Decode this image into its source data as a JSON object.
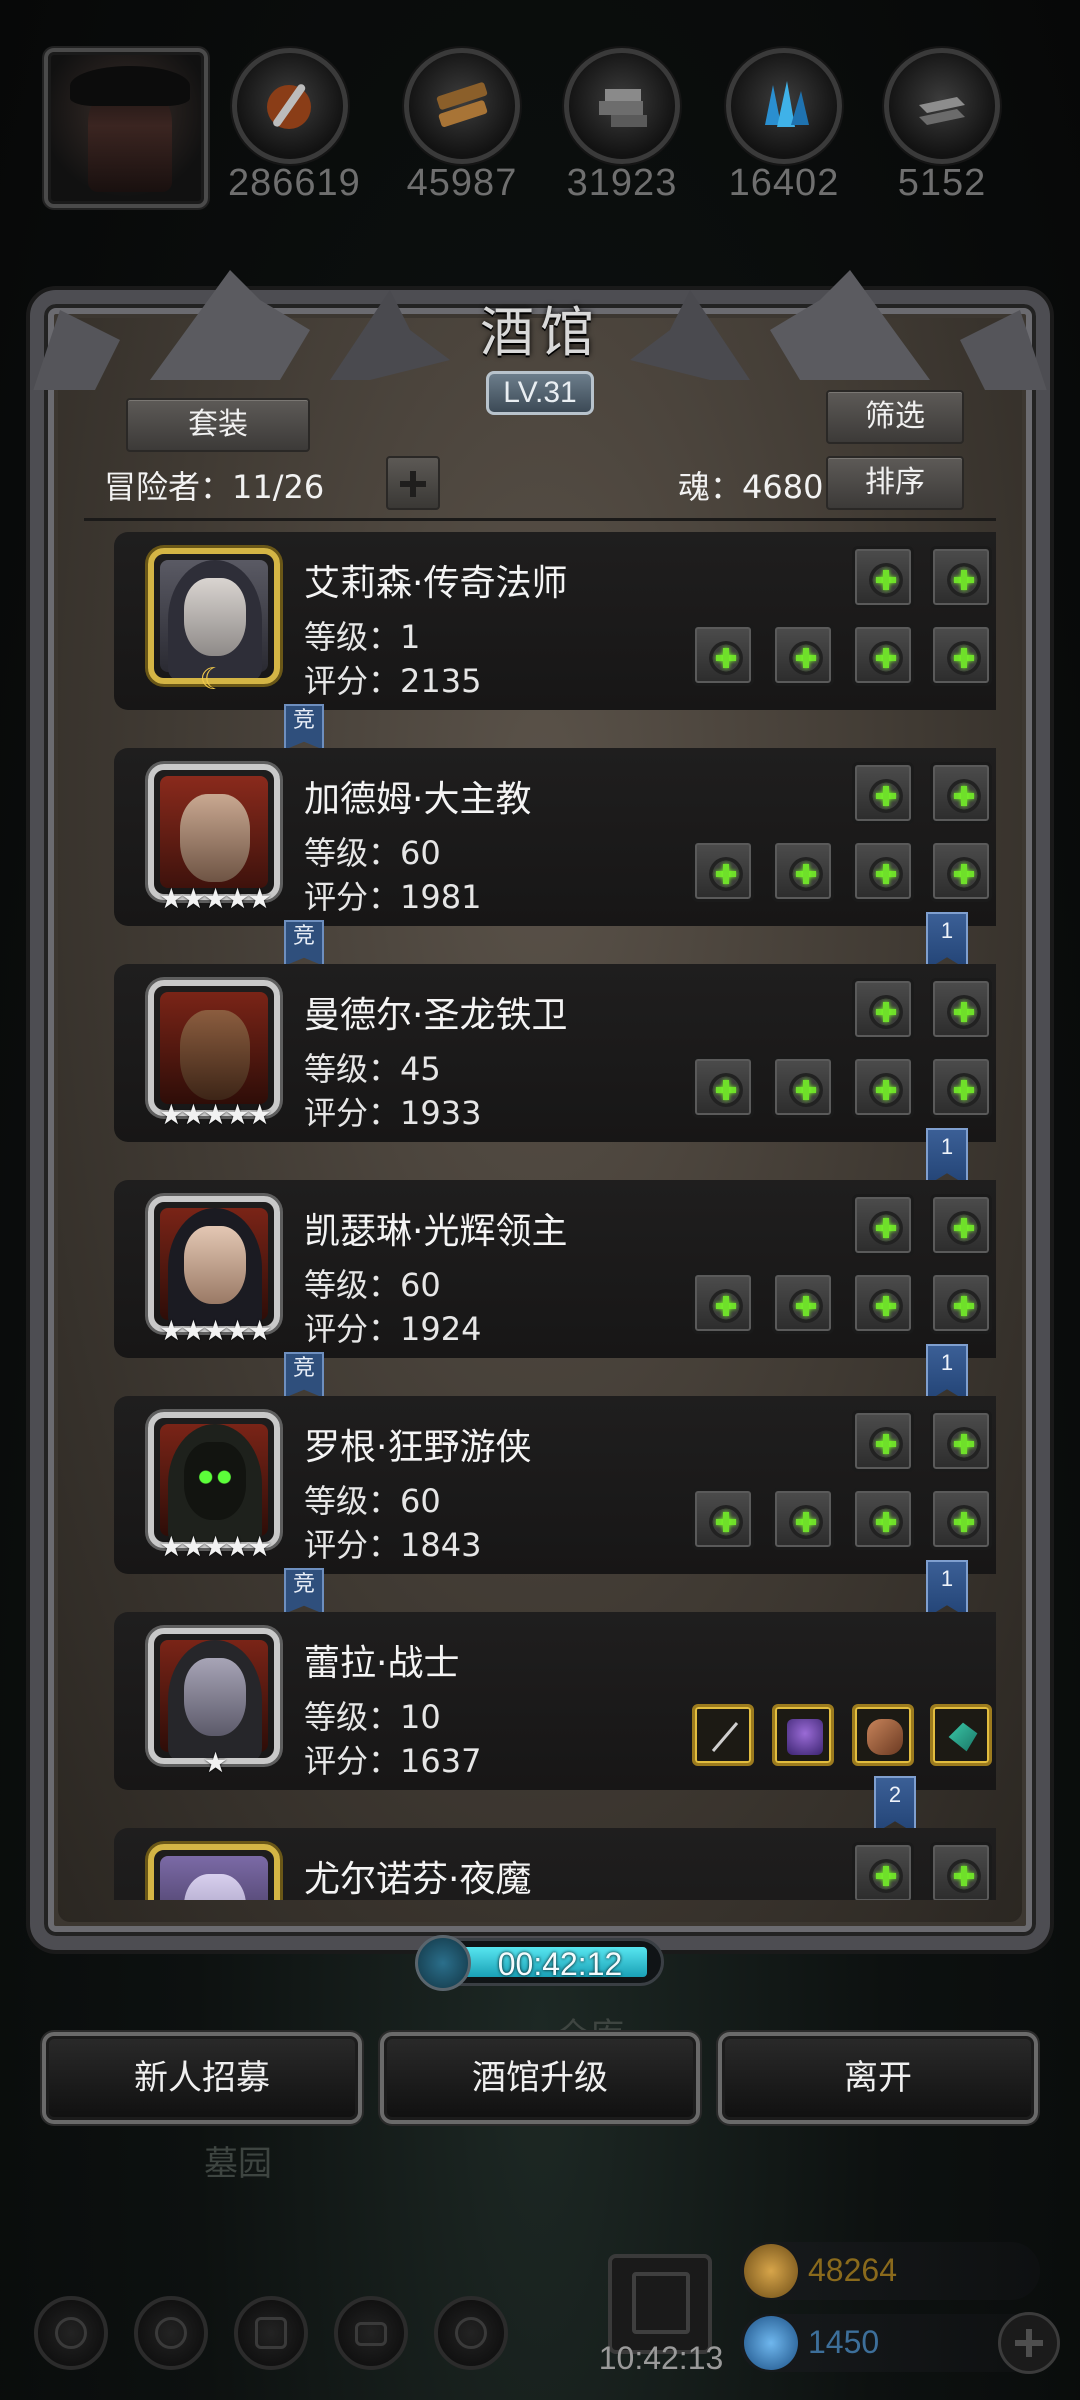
{
  "resources": [
    {
      "icon": "meat-icon",
      "value": "286619"
    },
    {
      "icon": "wood-icon",
      "value": "45987"
    },
    {
      "icon": "stone-icon",
      "value": "31923"
    },
    {
      "icon": "crystal-icon",
      "value": "16402"
    },
    {
      "icon": "iron-icon",
      "value": "5152"
    }
  ],
  "panel": {
    "title": "酒馆",
    "level": "LV.31",
    "set_button": "套装",
    "filter_button": "筛选",
    "sort_button": "排序",
    "adventurers": "冒险者：11/26",
    "soul": "魂：4680"
  },
  "heroes": [
    {
      "name": "艾莉森·传奇法师",
      "level": "等级：1",
      "score": "评分：2135",
      "stars": "",
      "badge": "crescent",
      "compete": "竞",
      "ribbon": ""
    },
    {
      "name": "加德姆·大主教",
      "level": "等级：60",
      "score": "评分：1981",
      "stars": "★★★★★",
      "compete": "竞",
      "ribbon": "1"
    },
    {
      "name": "曼德尔·圣龙铁卫",
      "level": "等级：45",
      "score": "评分：1933",
      "stars": "★★★★★",
      "compete": "",
      "ribbon": "1"
    },
    {
      "name": "凯瑟琳·光辉领主",
      "level": "等级：60",
      "score": "评分：1924",
      "stars": "★★★★★",
      "compete": "竞",
      "ribbon": "1"
    },
    {
      "name": "罗根·狂野游侠",
      "level": "等级：60",
      "score": "评分：1843",
      "stars": "★★★★★",
      "compete": "竞",
      "ribbon": "1"
    },
    {
      "name": "蕾拉·战士",
      "level": "等级：10",
      "score": "评分：1637",
      "stars": "★",
      "compete": "",
      "ribbon": "2"
    },
    {
      "name": "尤尔诺芬·夜魔",
      "level": "",
      "score": "",
      "stars": "",
      "compete": "",
      "ribbon": ""
    }
  ],
  "timer": "00:42:12",
  "buttons": {
    "recruit": "新人招募",
    "upgrade": "酒馆升级",
    "leave": "离开"
  },
  "background_labels": {
    "warehouse": "仓库",
    "cemetery": "墓园"
  },
  "dock": {
    "time": "10:42:13",
    "gold": "48264",
    "gems": "1450"
  },
  "colors": {
    "accent_green": "#6fe02a",
    "gold_text": "#8a6a1c",
    "gem_text": "#3d6f9a",
    "ribbon_blue": "#2f4f7c"
  }
}
